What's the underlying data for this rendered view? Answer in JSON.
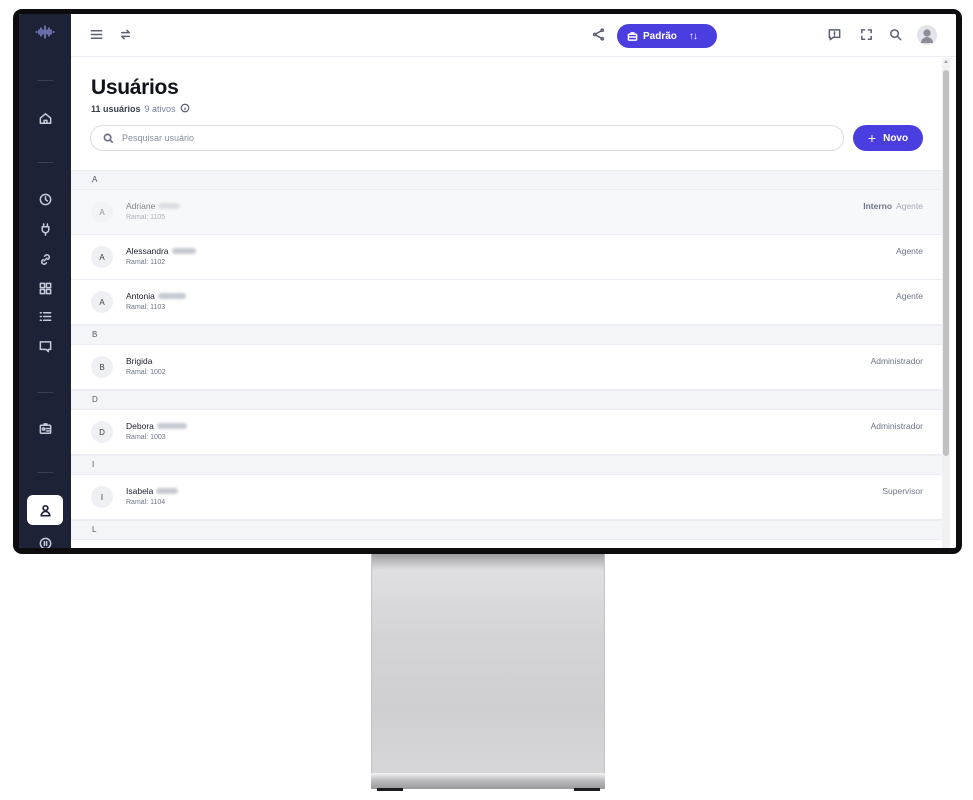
{
  "header": {
    "profile_label": "Padrão",
    "profile_arrows": "↑↓"
  },
  "page": {
    "title": "Usuários",
    "user_count": "11 usuários",
    "active_count": "9 ativos"
  },
  "search": {
    "placeholder": "Pesquisar usuário"
  },
  "actions": {
    "new_label": "Novo",
    "new_symbol": "+"
  },
  "groups": [
    {
      "letter": "A",
      "users": [
        {
          "initial": "A",
          "name": "Adriane",
          "ramal": "Ramal: 1105",
          "tag": "Interno",
          "role": "Agente",
          "inactive": true
        },
        {
          "initial": "A",
          "name": "Alessandra",
          "ramal": "Ramal: 1102",
          "tag": "",
          "role": "Agente",
          "inactive": false
        },
        {
          "initial": "A",
          "name": "Antonia",
          "ramal": "Ramal: 1103",
          "tag": "",
          "role": "Agente",
          "inactive": false
        }
      ]
    },
    {
      "letter": "B",
      "users": [
        {
          "initial": "B",
          "name": "Brigida",
          "ramal": "Ramal: 1002",
          "tag": "",
          "role": "Administrador",
          "inactive": false
        }
      ]
    },
    {
      "letter": "D",
      "users": [
        {
          "initial": "D",
          "name": "Debora",
          "ramal": "Ramal: 1003",
          "tag": "",
          "role": "Administrador",
          "inactive": false
        }
      ]
    },
    {
      "letter": "I",
      "users": [
        {
          "initial": "I",
          "name": "Isabela",
          "ramal": "Ramal: 1104",
          "tag": "",
          "role": "Supervisor",
          "inactive": false
        }
      ]
    },
    {
      "letter": "L",
      "users": []
    }
  ],
  "colors": {
    "accent": "#4b3ee0",
    "sidebar": "#1e2236"
  }
}
